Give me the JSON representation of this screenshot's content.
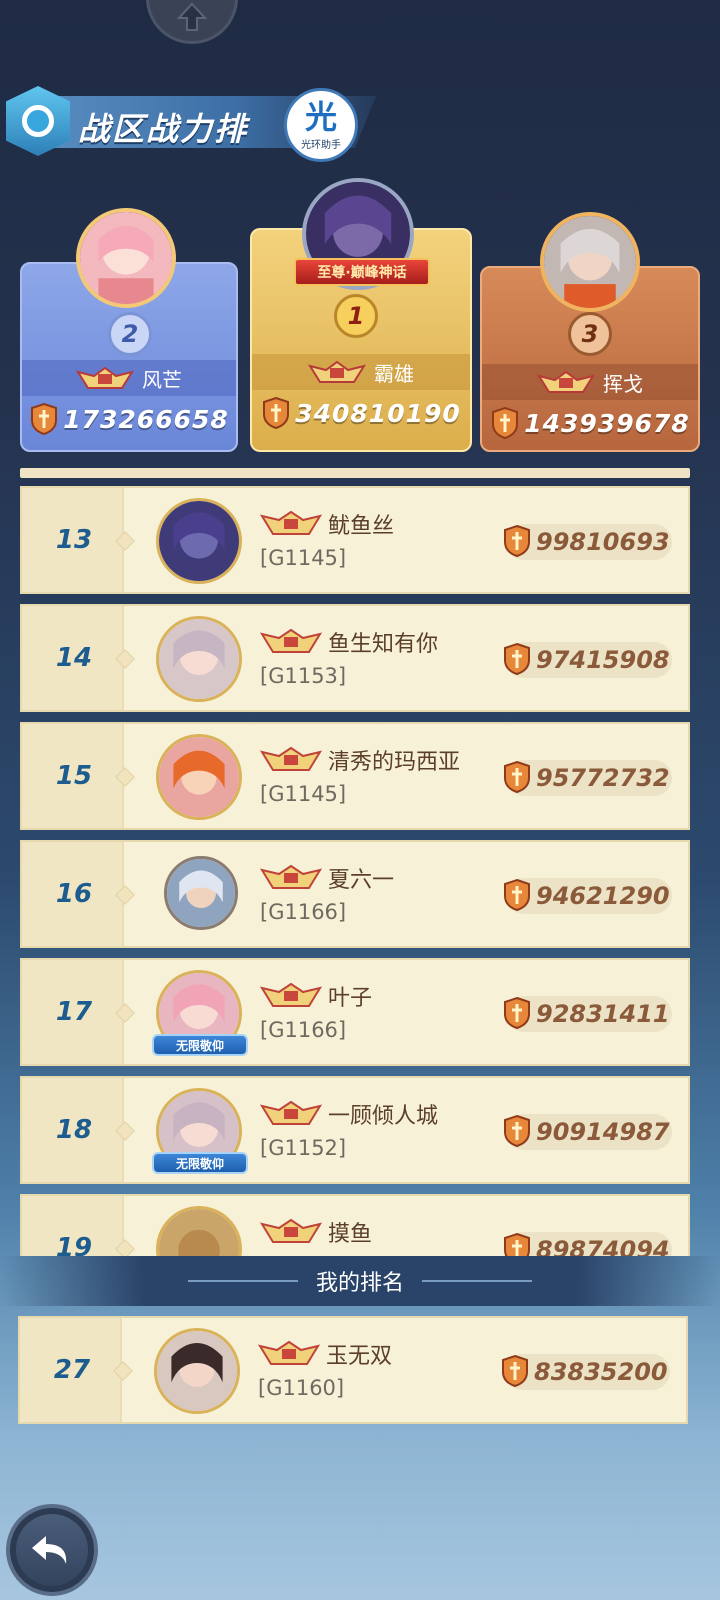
{
  "header": {
    "title": "战区战力排",
    "badge_char": "光",
    "badge_sub": "光环助手"
  },
  "podium": [
    {
      "rank": "2",
      "name": "风芒",
      "power": "173266658"
    },
    {
      "rank": "1",
      "name": "霸雄",
      "power": "340810190",
      "tag": "至尊·巅峰神话"
    },
    {
      "rank": "3",
      "name": "挥戈",
      "power": "143939678"
    }
  ],
  "rows": [
    {
      "rank": "13",
      "name": "鱿鱼丝",
      "server": "[G1145]",
      "power": "99810693",
      "worship": ""
    },
    {
      "rank": "14",
      "name": "鱼生知有你",
      "server": "[G1153]",
      "power": "97415908",
      "worship": ""
    },
    {
      "rank": "15",
      "name": "清秀的玛西亚",
      "server": "[G1145]",
      "power": "95772732",
      "worship": ""
    },
    {
      "rank": "16",
      "name": "夏六一",
      "server": "[G1166]",
      "power": "94621290",
      "worship": ""
    },
    {
      "rank": "17",
      "name": "叶子",
      "server": "[G1166]",
      "power": "92831411",
      "worship": "无限敬仰"
    },
    {
      "rank": "18",
      "name": "一顾倾人城",
      "server": "[G1152]",
      "power": "90914987",
      "worship": "无限敬仰"
    },
    {
      "rank": "19",
      "name": "摸鱼",
      "server": "",
      "power": "89874094",
      "worship": ""
    }
  ],
  "my_rank": {
    "header": "我的排名",
    "rank": "27",
    "name": "玉无双",
    "server": "[G1160]",
    "power": "83835200"
  },
  "colors": {
    "rank_blue": "#1d5c8f",
    "power_brown": "#8a5a3b",
    "gold_card": "#dcae4b",
    "silver_card": "#6a86d8",
    "bronze_card": "#b7663e"
  }
}
